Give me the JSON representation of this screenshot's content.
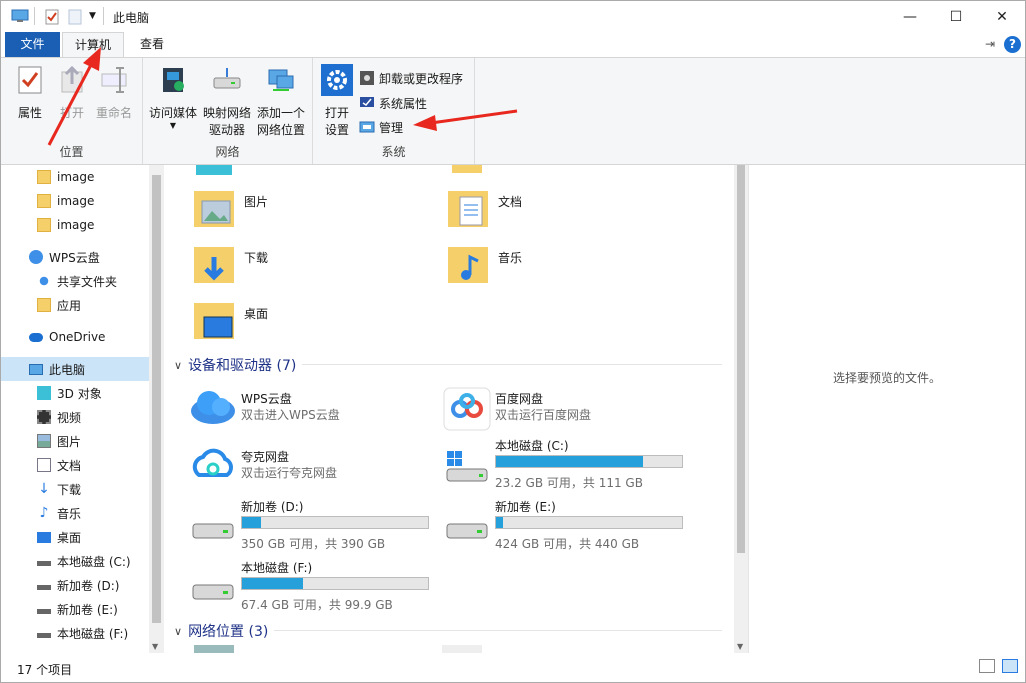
{
  "window": {
    "title": "此电脑"
  },
  "tabs": {
    "file": "文件",
    "computer": "计算机",
    "view": "查看"
  },
  "ribbon": {
    "location": {
      "label": "位置",
      "properties": "属性",
      "open": "打开",
      "rename": "重命名"
    },
    "network": {
      "label": "网络",
      "access_media": "访问媒体",
      "map_drive_1": "映射网络",
      "map_drive_2": "驱动器",
      "add_location_1": "添加一个",
      "add_location_2": "网络位置"
    },
    "system": {
      "label": "系统",
      "open_settings_1": "打开",
      "open_settings_2": "设置",
      "uninstall": "卸载或更改程序",
      "sys_props": "系统属性",
      "manage": "管理"
    }
  },
  "nav": {
    "items": [
      {
        "label": "image",
        "icon": "folder-icon"
      },
      {
        "label": "image",
        "icon": "folder-icon"
      },
      {
        "label": "image",
        "icon": "folder-icon"
      },
      {
        "label": "WPS云盘",
        "icon": "cloud-icon"
      },
      {
        "label": "共享文件夹",
        "icon": "share-icon"
      },
      {
        "label": "应用",
        "icon": "folder-icon"
      },
      {
        "label": "OneDrive",
        "icon": "onedrive-icon"
      },
      {
        "label": "此电脑",
        "icon": "pc-icon"
      },
      {
        "label": "3D 对象",
        "icon": "cube-icon"
      },
      {
        "label": "视频",
        "icon": "video-icon"
      },
      {
        "label": "图片",
        "icon": "picture-icon"
      },
      {
        "label": "文档",
        "icon": "document-icon"
      },
      {
        "label": "下载",
        "icon": "download-icon"
      },
      {
        "label": "音乐",
        "icon": "music-icon"
      },
      {
        "label": "桌面",
        "icon": "desktop-icon"
      },
      {
        "label": "本地磁盘 (C:)",
        "icon": "drive-icon"
      },
      {
        "label": "新加卷 (D:)",
        "icon": "drive-icon"
      },
      {
        "label": "新加卷 (E:)",
        "icon": "drive-icon"
      },
      {
        "label": "本地磁盘 (F:)",
        "icon": "drive-icon"
      }
    ]
  },
  "folders": [
    {
      "label": "图片"
    },
    {
      "label": "文档"
    },
    {
      "label": "下载"
    },
    {
      "label": "音乐"
    },
    {
      "label": "桌面"
    }
  ],
  "devices_header": "设备和驱动器 (7)",
  "network_header": "网络位置 (3)",
  "devices": [
    {
      "name": "WPS云盘",
      "sub": "双击进入WPS云盘"
    },
    {
      "name": "百度网盘",
      "sub": "双击运行百度网盘"
    },
    {
      "name": "夸克网盘",
      "sub": "双击运行夸克网盘"
    },
    {
      "name": "本地磁盘 (C:)",
      "free": "23.2 GB 可用，共 111 GB",
      "used_pct": 79
    },
    {
      "name": "新加卷 (D:)",
      "free": "350 GB 可用，共 390 GB",
      "used_pct": 10
    },
    {
      "name": "新加卷 (E:)",
      "free": "424 GB 可用，共 440 GB",
      "used_pct": 4
    },
    {
      "name": "本地磁盘 (F:)",
      "free": "67.4 GB 可用，共 99.9 GB",
      "used_pct": 33
    }
  ],
  "preview": {
    "text": "选择要预览的文件。"
  },
  "status": {
    "count": "17 个项目"
  },
  "colors": {
    "accent": "#1a5fb4",
    "selection": "#cce4f7",
    "drive_bar": "#26a0da",
    "arrow": "#e8281e"
  }
}
